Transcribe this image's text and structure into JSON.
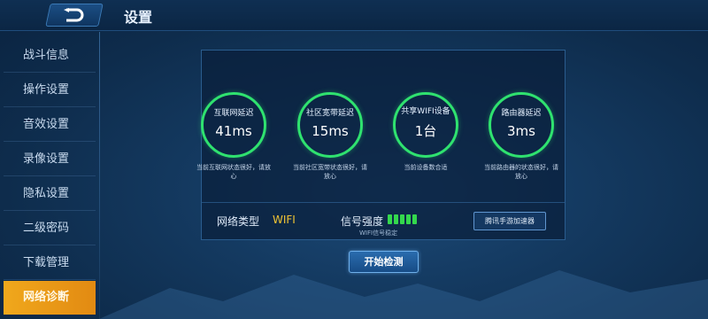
{
  "header": {
    "title": "设置"
  },
  "sidebar": {
    "items": [
      {
        "label": "战斗信息"
      },
      {
        "label": "操作设置"
      },
      {
        "label": "音效设置"
      },
      {
        "label": "录像设置"
      },
      {
        "label": "隐私设置"
      },
      {
        "label": "二级密码"
      },
      {
        "label": "下载管理"
      },
      {
        "label": "网络诊断"
      }
    ],
    "active": "网络诊断"
  },
  "metrics": [
    {
      "label": "互联网延迟",
      "value": "41ms",
      "desc": "当前互联网状态很好，请放心"
    },
    {
      "label": "社区宽带延迟",
      "value": "15ms",
      "desc": "当前社区宽带状态很好，请放心"
    },
    {
      "label": "共享WIFI设备",
      "value": "1台",
      "desc": "当前设备数合适"
    },
    {
      "label": "路由器延迟",
      "value": "3ms",
      "desc": "当前路由器的状态很好，请放心"
    }
  ],
  "network": {
    "type_label": "网络类型",
    "type_value": "WIFI",
    "signal_label": "信号强度",
    "signal_bars": 5,
    "signal_status": "WIFI信号稳定",
    "accelerator_button": "腾讯手游加速器"
  },
  "actions": {
    "start_button": "开始检测"
  },
  "colors": {
    "ring": "#2fe26f",
    "active_tab": "#f0a81c",
    "wifi_value": "#f3c533",
    "signal": "#34d84d"
  },
  "icons": {
    "back": "back-arrow-icon"
  }
}
